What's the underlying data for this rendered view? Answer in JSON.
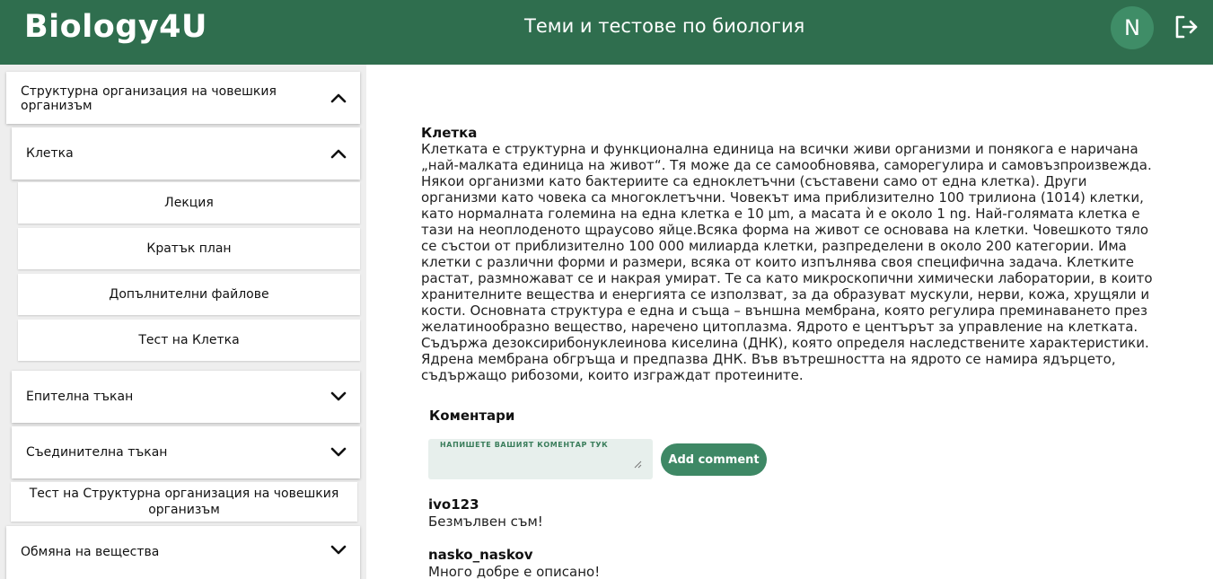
{
  "header": {
    "logo": "Biology4U",
    "title": "Теми и тестове по биология",
    "avatar_initial": "N",
    "logout_icon": "logout-icon",
    "bg_color": "#2f6e4e"
  },
  "sidebar": {
    "section": {
      "label": "Структурна организация на човешкия организъм",
      "expanded": true
    },
    "topic": {
      "label": "Клетка",
      "expanded": true
    },
    "topic_items": [
      "Лекция",
      "Кратък план",
      "Допълнителни файлове",
      "Тест на Клетка"
    ],
    "epithelial": "Епителна тъкан",
    "connective": "Съединителна тъкан",
    "section_test": "Тест на Структурна организация на човешкия организъм",
    "metabolism": "Обмяна на вещества"
  },
  "article": {
    "title": "Клетка",
    "body": "Клетката е структурна и функционална единица на всички живи организми и понякога е наричана „най-малката единица на живот“. Тя може да се самообновява, саморегулира и самовъзпроизвежда. Някои организми като бактериите са едноклетъчни (съставени само от една клетка). Други организми като човека са многоклетъчни. Човекът има приблизително 100 трилиона (1014) клетки, като нормалната големина на една клетка е 10 µm, а масата ѝ е около 1 ng. Най-голямата клетка е тази на неоплоденото щраусово яйце.Всяка форма на живот се основава на клетки. Човешкото тяло се състои от приблизително 100 000 милиарда клетки, разпределени в около 200 категории. Има клетки с различни форми и размери, всяка от които изпълнява своя специфична задача. Клетките растат, размножават се и накрая умират. Те са като микроскопични химически лаборатории, в които хранителните вещества и енергията се използват, за да образуват мускули, нерви, кожа, хрущяли и кости. Основната структура е една и съща – външна мембрана, която регулира преминаването през желатинообразно вещество, наречено цитоплазма. Ядрото е центърът за управление на клетката. Съдържа дезоксирибонуклеинова киселина (ДНК), която определя наследствените характеристики. Ядрена мембрана обгръща и предпазва ДНК. Във вътрешността на ядрото се намира ядърцето, съдържащо рибозоми, които изграждат протеините."
  },
  "comments": {
    "heading": "Коментари",
    "placeholder": "НАПИШЕТЕ ВАШИЯТ КОМЕНТАР ТУК",
    "add_label": "Add comment",
    "items": [
      {
        "user": "ivo123",
        "text": "Безмълвен съм!"
      },
      {
        "user": "nasko_naskov",
        "text": "Много добре е описано!"
      }
    ]
  }
}
